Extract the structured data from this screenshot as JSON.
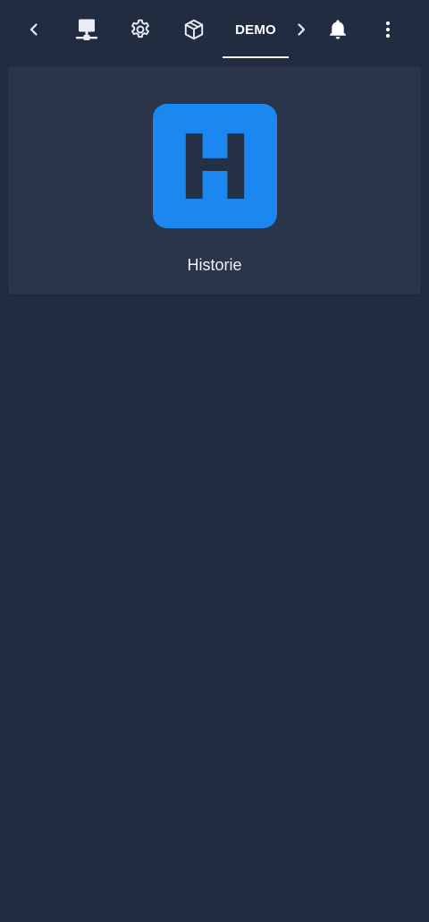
{
  "toolbar": {
    "icons": {
      "back": "chevron-left-icon",
      "network": "monitor-network-icon",
      "settings": "gear-icon",
      "package": "cube-icon",
      "forward": "chevron-right-icon",
      "notifications": "bell-icon",
      "more": "more-vertical-icon"
    },
    "active_tab_label": "DEMO"
  },
  "content": {
    "tile": {
      "letter": "H",
      "label": "Historie",
      "color": "#1b88f1"
    }
  },
  "colors": {
    "background": "#222c40",
    "card": "#2b354a",
    "accent": "#1b88f1",
    "text": "#eef1f6"
  }
}
